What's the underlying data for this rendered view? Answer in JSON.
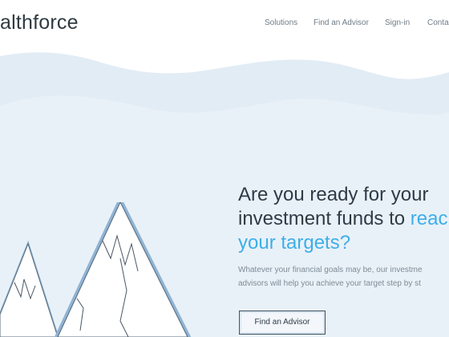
{
  "header": {
    "logo_text": "althforce",
    "nav": [
      {
        "label": "Solutions"
      },
      {
        "label": "Find an Advisor"
      },
      {
        "label": "Sign-in"
      },
      {
        "label": "Contac"
      }
    ]
  },
  "hero": {
    "headline_line1": "Are you ready for your",
    "headline_line2_main": "investment funds to ",
    "headline_line2_accent": "reac",
    "headline_line3_accent": "your targets?",
    "subtext_line1": "Whatever your financial goals may be, our investme",
    "subtext_line2": "advisors will help you achieve your target step by st",
    "cta_label": "Find an Advisor"
  },
  "illustration": {
    "icon": "mountain-with-flag-icon"
  },
  "colors": {
    "accent": "#3daee9",
    "hero_bg": "#e9f1f8",
    "text_dark": "#2e3b46",
    "text_muted": "#7d8b96"
  }
}
